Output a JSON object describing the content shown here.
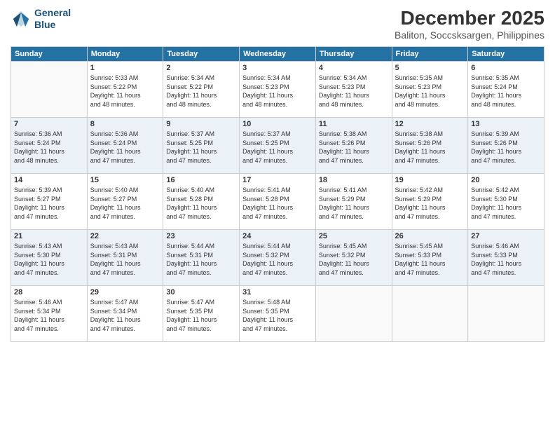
{
  "logo": {
    "line1": "General",
    "line2": "Blue"
  },
  "title": "December 2025",
  "subtitle": "Baliton, Soccsksargen, Philippines",
  "headers": [
    "Sunday",
    "Monday",
    "Tuesday",
    "Wednesday",
    "Thursday",
    "Friday",
    "Saturday"
  ],
  "weeks": [
    [
      {
        "day": "",
        "info": ""
      },
      {
        "day": "1",
        "info": "Sunrise: 5:33 AM\nSunset: 5:22 PM\nDaylight: 11 hours\nand 48 minutes."
      },
      {
        "day": "2",
        "info": "Sunrise: 5:34 AM\nSunset: 5:22 PM\nDaylight: 11 hours\nand 48 minutes."
      },
      {
        "day": "3",
        "info": "Sunrise: 5:34 AM\nSunset: 5:23 PM\nDaylight: 11 hours\nand 48 minutes."
      },
      {
        "day": "4",
        "info": "Sunrise: 5:34 AM\nSunset: 5:23 PM\nDaylight: 11 hours\nand 48 minutes."
      },
      {
        "day": "5",
        "info": "Sunrise: 5:35 AM\nSunset: 5:23 PM\nDaylight: 11 hours\nand 48 minutes."
      },
      {
        "day": "6",
        "info": "Sunrise: 5:35 AM\nSunset: 5:24 PM\nDaylight: 11 hours\nand 48 minutes."
      }
    ],
    [
      {
        "day": "7",
        "info": "Sunrise: 5:36 AM\nSunset: 5:24 PM\nDaylight: 11 hours\nand 48 minutes."
      },
      {
        "day": "8",
        "info": "Sunrise: 5:36 AM\nSunset: 5:24 PM\nDaylight: 11 hours\nand 47 minutes."
      },
      {
        "day": "9",
        "info": "Sunrise: 5:37 AM\nSunset: 5:25 PM\nDaylight: 11 hours\nand 47 minutes."
      },
      {
        "day": "10",
        "info": "Sunrise: 5:37 AM\nSunset: 5:25 PM\nDaylight: 11 hours\nand 47 minutes."
      },
      {
        "day": "11",
        "info": "Sunrise: 5:38 AM\nSunset: 5:26 PM\nDaylight: 11 hours\nand 47 minutes."
      },
      {
        "day": "12",
        "info": "Sunrise: 5:38 AM\nSunset: 5:26 PM\nDaylight: 11 hours\nand 47 minutes."
      },
      {
        "day": "13",
        "info": "Sunrise: 5:39 AM\nSunset: 5:26 PM\nDaylight: 11 hours\nand 47 minutes."
      }
    ],
    [
      {
        "day": "14",
        "info": "Sunrise: 5:39 AM\nSunset: 5:27 PM\nDaylight: 11 hours\nand 47 minutes."
      },
      {
        "day": "15",
        "info": "Sunrise: 5:40 AM\nSunset: 5:27 PM\nDaylight: 11 hours\nand 47 minutes."
      },
      {
        "day": "16",
        "info": "Sunrise: 5:40 AM\nSunset: 5:28 PM\nDaylight: 11 hours\nand 47 minutes."
      },
      {
        "day": "17",
        "info": "Sunrise: 5:41 AM\nSunset: 5:28 PM\nDaylight: 11 hours\nand 47 minutes."
      },
      {
        "day": "18",
        "info": "Sunrise: 5:41 AM\nSunset: 5:29 PM\nDaylight: 11 hours\nand 47 minutes."
      },
      {
        "day": "19",
        "info": "Sunrise: 5:42 AM\nSunset: 5:29 PM\nDaylight: 11 hours\nand 47 minutes."
      },
      {
        "day": "20",
        "info": "Sunrise: 5:42 AM\nSunset: 5:30 PM\nDaylight: 11 hours\nand 47 minutes."
      }
    ],
    [
      {
        "day": "21",
        "info": "Sunrise: 5:43 AM\nSunset: 5:30 PM\nDaylight: 11 hours\nand 47 minutes."
      },
      {
        "day": "22",
        "info": "Sunrise: 5:43 AM\nSunset: 5:31 PM\nDaylight: 11 hours\nand 47 minutes."
      },
      {
        "day": "23",
        "info": "Sunrise: 5:44 AM\nSunset: 5:31 PM\nDaylight: 11 hours\nand 47 minutes."
      },
      {
        "day": "24",
        "info": "Sunrise: 5:44 AM\nSunset: 5:32 PM\nDaylight: 11 hours\nand 47 minutes."
      },
      {
        "day": "25",
        "info": "Sunrise: 5:45 AM\nSunset: 5:32 PM\nDaylight: 11 hours\nand 47 minutes."
      },
      {
        "day": "26",
        "info": "Sunrise: 5:45 AM\nSunset: 5:33 PM\nDaylight: 11 hours\nand 47 minutes."
      },
      {
        "day": "27",
        "info": "Sunrise: 5:46 AM\nSunset: 5:33 PM\nDaylight: 11 hours\nand 47 minutes."
      }
    ],
    [
      {
        "day": "28",
        "info": "Sunrise: 5:46 AM\nSunset: 5:34 PM\nDaylight: 11 hours\nand 47 minutes."
      },
      {
        "day": "29",
        "info": "Sunrise: 5:47 AM\nSunset: 5:34 PM\nDaylight: 11 hours\nand 47 minutes."
      },
      {
        "day": "30",
        "info": "Sunrise: 5:47 AM\nSunset: 5:35 PM\nDaylight: 11 hours\nand 47 minutes."
      },
      {
        "day": "31",
        "info": "Sunrise: 5:48 AM\nSunset: 5:35 PM\nDaylight: 11 hours\nand 47 minutes."
      },
      {
        "day": "",
        "info": ""
      },
      {
        "day": "",
        "info": ""
      },
      {
        "day": "",
        "info": ""
      }
    ]
  ]
}
